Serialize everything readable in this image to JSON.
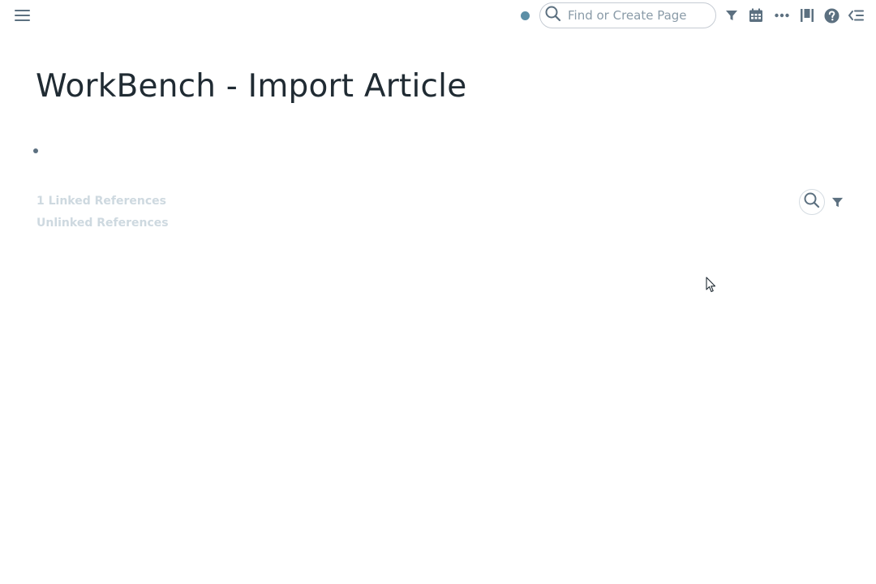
{
  "topbar": {
    "menu_icon": "hamburger-menu-icon",
    "sync_status_color": "#5c8fa6",
    "search": {
      "placeholder": "Find or Create Page",
      "value": "",
      "icon": "search-icon"
    },
    "icons": [
      "filter-icon",
      "calendar-icon",
      "more-horizontal-icon",
      "all-pages-icon",
      "help-icon",
      "right-sidebar-icon"
    ],
    "icon_color": "#5c7080"
  },
  "page": {
    "title": "WorkBench - Import Article"
  },
  "references": {
    "linked_label": "1 Linked References",
    "unlinked_label": "Unlinked References",
    "label_color": "#ced9e0"
  }
}
